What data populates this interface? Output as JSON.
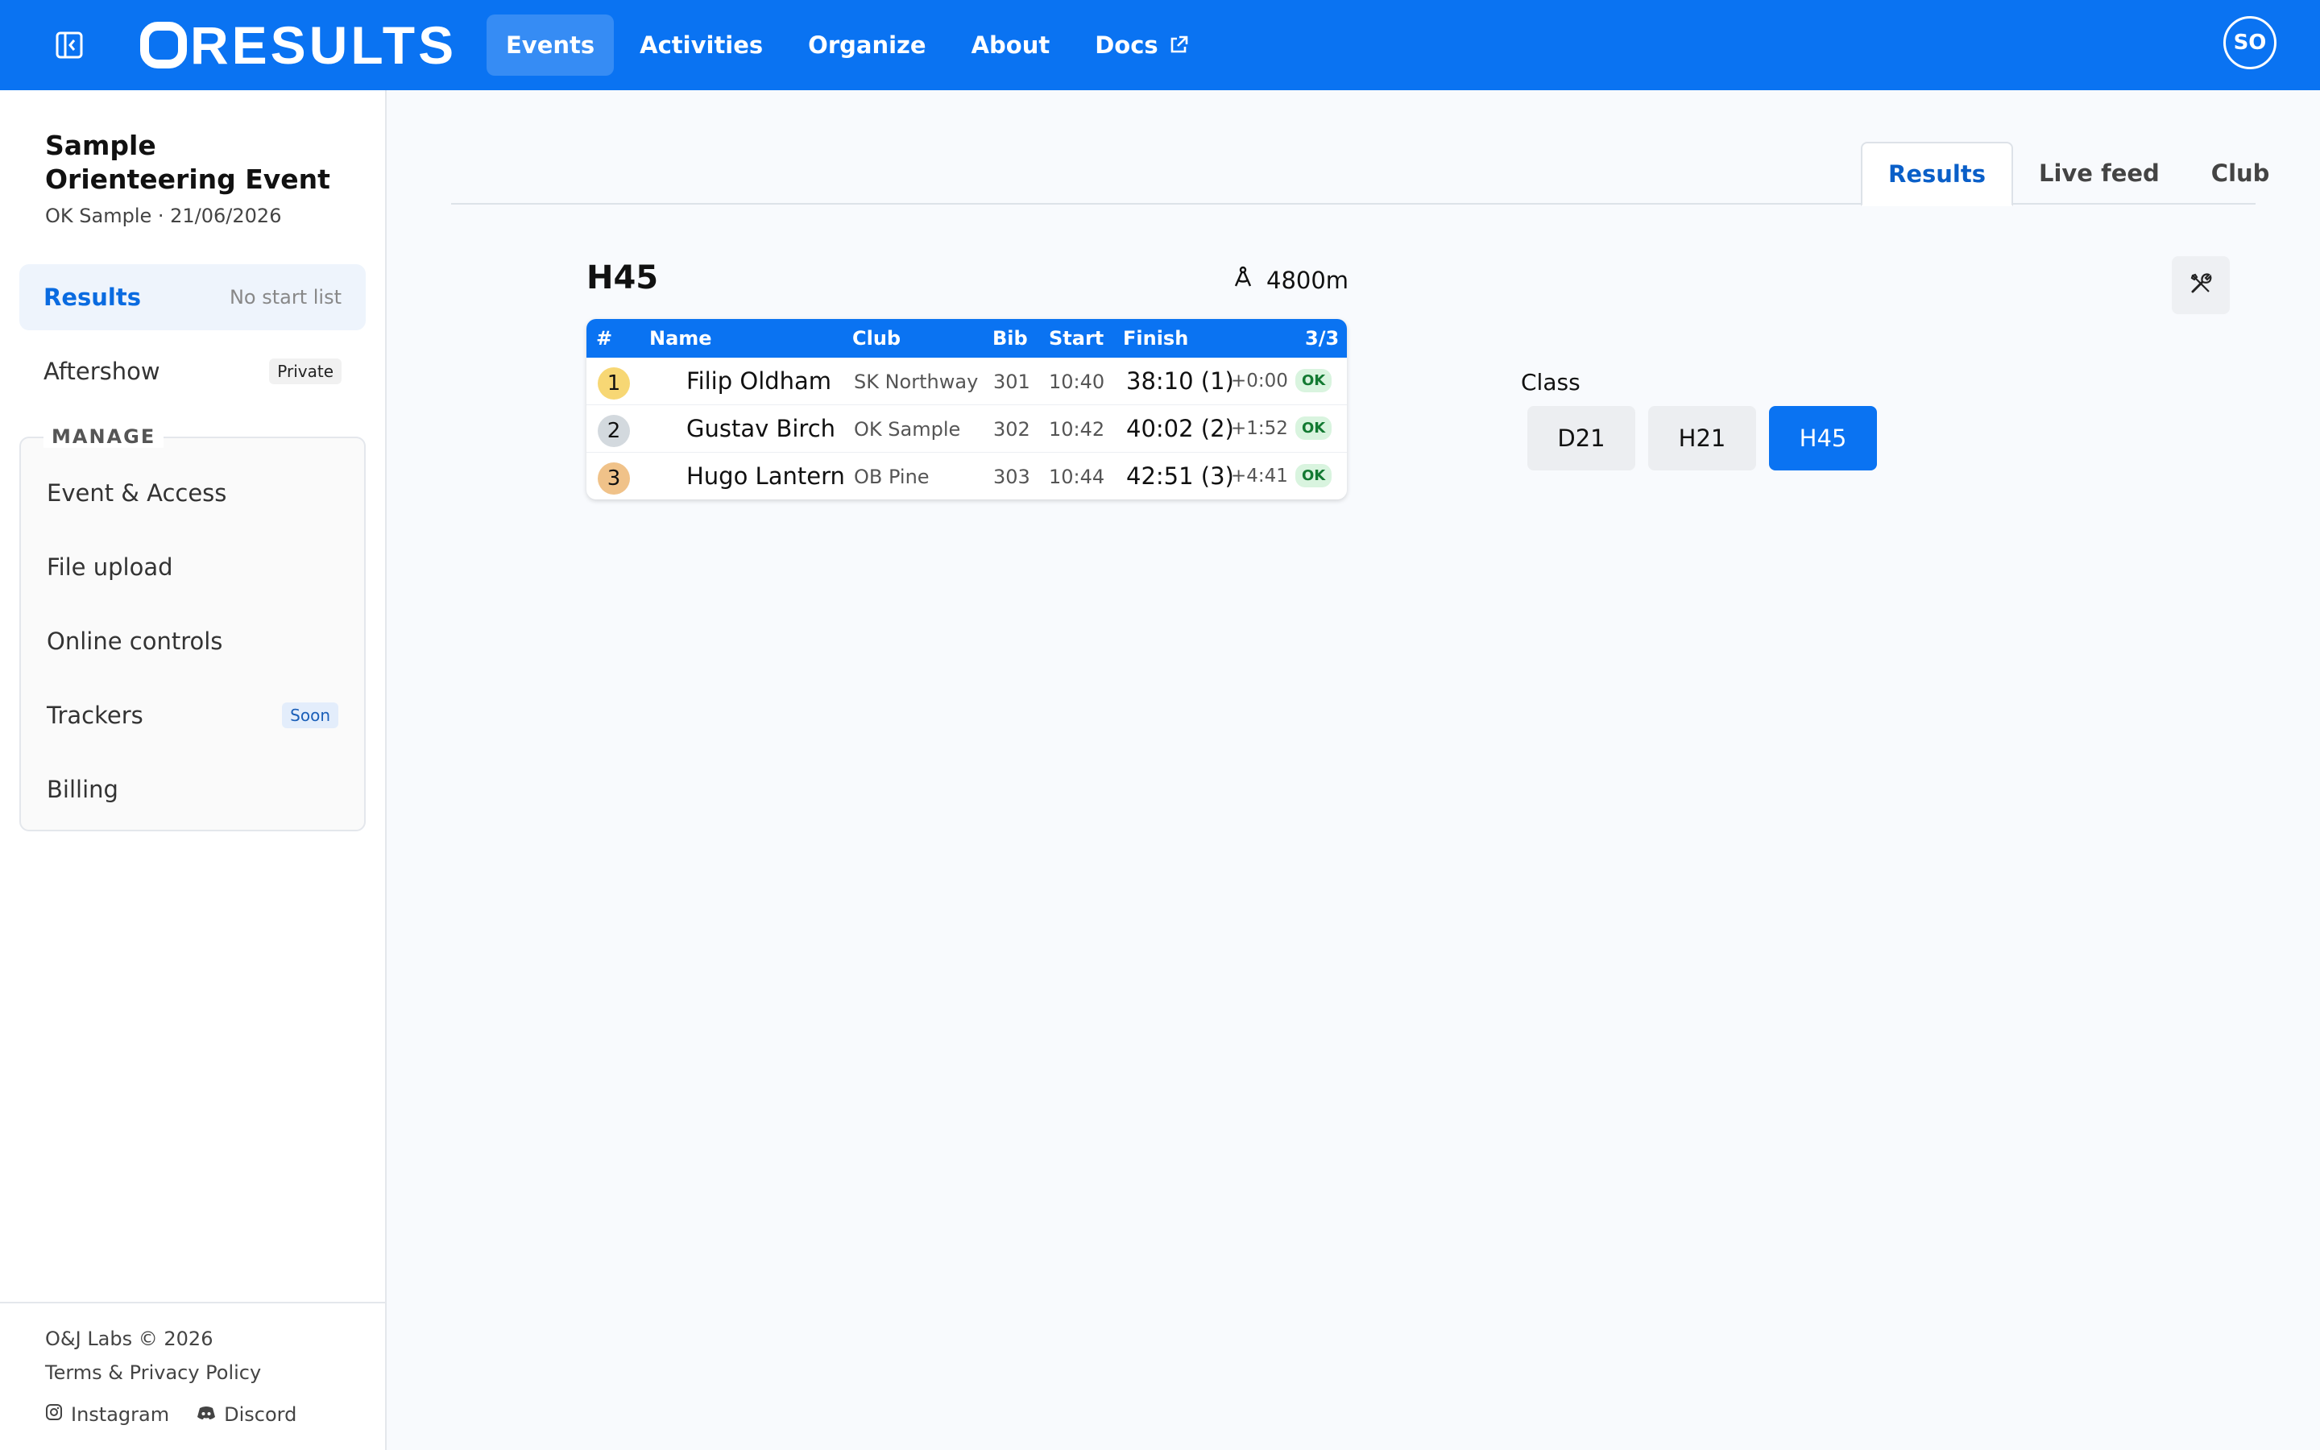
{
  "brand": {
    "logo_text": "RESULTS"
  },
  "nav": {
    "items": [
      {
        "label": "Events",
        "active": true
      },
      {
        "label": "Activities"
      },
      {
        "label": "Organize"
      },
      {
        "label": "About"
      },
      {
        "label": "Docs",
        "icon": "external-link-icon"
      }
    ]
  },
  "user": {
    "initials": "SO"
  },
  "sidebar": {
    "event_title": "Sample Orienteering Event",
    "event_subtitle": "OK Sample · 21/06/2026",
    "results": {
      "label": "Results",
      "hint": "No start list"
    },
    "aftershow": {
      "label": "Aftershow",
      "badge": "Private"
    },
    "manage": {
      "heading": "MANAGE",
      "items": [
        {
          "label": "Event & Access"
        },
        {
          "label": "File upload"
        },
        {
          "label": "Online controls"
        },
        {
          "label": "Trackers",
          "badge": "Soon"
        },
        {
          "label": "Billing"
        }
      ]
    },
    "footer": {
      "copyright": "O&J Labs © 2026",
      "terms": "Terms & Privacy Policy",
      "instagram": "Instagram",
      "discord": "Discord"
    }
  },
  "tabs": [
    {
      "label": "Results",
      "active": true
    },
    {
      "label": "Live feed"
    },
    {
      "label": "Club"
    }
  ],
  "class_view": {
    "heading": "H45",
    "distance": "4800m",
    "columns": {
      "pos": "#",
      "name": "Name",
      "club": "Club",
      "bib": "Bib",
      "start": "Start",
      "finish": "Finish",
      "count": "3/3"
    },
    "rows": [
      {
        "pos": "1",
        "name": "Filip Oldham",
        "club": "SK Northway",
        "bib": "301",
        "start": "10:40",
        "finish": "38:10 (1)",
        "diff": "+0:00",
        "status": "OK",
        "medal_color": "#f7d774"
      },
      {
        "pos": "2",
        "name": "Gustav Birch",
        "club": "OK Sample",
        "bib": "302",
        "start": "10:42",
        "finish": "40:02 (2)",
        "diff": "+1:52",
        "status": "OK",
        "medal_color": "#d3d9de"
      },
      {
        "pos": "3",
        "name": "Hugo Lantern",
        "club": "OB Pine",
        "bib": "303",
        "start": "10:44",
        "finish": "42:51 (3)",
        "diff": "+4:41",
        "status": "OK",
        "medal_color": "#f0c289"
      }
    ]
  },
  "class_selector": {
    "label": "Class",
    "options": [
      {
        "label": "D21"
      },
      {
        "label": "H21"
      },
      {
        "label": "H45",
        "active": true
      }
    ]
  },
  "colors": {
    "primary": "#0a73f2",
    "ok_badge_bg": "#d9f4df",
    "ok_badge_fg": "#137a32"
  }
}
